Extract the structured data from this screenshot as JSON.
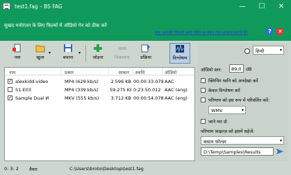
{
  "window": {
    "title": "test1.fag – BS FAG",
    "minimize_glyph": "—",
    "maximize_glyph": "☐",
    "close_glyph": "✕"
  },
  "banner": {
    "message": "सुखद मनोरंजन के लिए फिल्मों में ऑडियो गेन को ठीक करें",
    "hint_link": "क्या आपको फिल्मों बहुत धीमी या बहुत तेज़ आवाज़ लगती है?",
    "help_glyph": "?",
    "close_glyph": "✕"
  },
  "toolbar": {
    "new_label": "नया",
    "open_label": "खुला",
    "save_label": "बचाना",
    "add_label": "जोड़ना",
    "remove_label": "निकालना",
    "process_label": "प्रक्रिया",
    "analyze_label": "विश्लेषण",
    "caret": "▾"
  },
  "list": {
    "columns": [
      "नाम",
      "प्रकार",
      "आकार",
      "अवधि",
      "ऑडियो"
    ],
    "rows": [
      {
        "checked": true,
        "name": "alexkidd-video",
        "type": "MP4 (629 kb/s)",
        "size": "2.596 KB",
        "duration": "00:00:33.079",
        "audio": "AAC"
      },
      {
        "checked": false,
        "name": "S1-E03",
        "type": "MP4 (339 kb/s)",
        "size": "59.275 KB",
        "duration": "0:23:50.012",
        "audio": "AAC (eng)"
      },
      {
        "checked": true,
        "name": "Sample Dual И",
        "type": "MKV (555 kb/s)",
        "size": "3.712 KB",
        "duration": "00:00:54.078",
        "audio": "AAC (eng)"
      }
    ],
    "check_glyph": "✓"
  },
  "side": {
    "language": "हिन्दी",
    "level_label": "ऑडियो स्तर:",
    "level_value": "89,0",
    "level_unit": "dB",
    "opt_ignore_clipping": "क्लिपिंग ध्वनि को अनदेखा करें",
    "opt_analysis_only": "केवल विश्लेषण करें",
    "opt_convert_result": "परिणाम को इस रूप में परिवर्तित करें:",
    "format": "WMV",
    "opt_shutdown": "जाने मत दो",
    "save_results_label": "परिणाम फ़ाइल्ज़ को इसमें सहेजें:",
    "folder_mode": "कस्टम फ़ोल्डर",
    "output_path": "D:\\Temp\\Samples\\Results",
    "dropdown_glyph": "▾"
  },
  "status": {
    "counts": "0: 3: 2",
    "state": "तैयार",
    "file_path": "C:\\Users\\broto\\Desktop\\test1.fag"
  },
  "colors": {
    "title_green": "#0f9a5c",
    "panel_bg": "#cdd6cf",
    "link_blue": "#2a3fd4"
  }
}
